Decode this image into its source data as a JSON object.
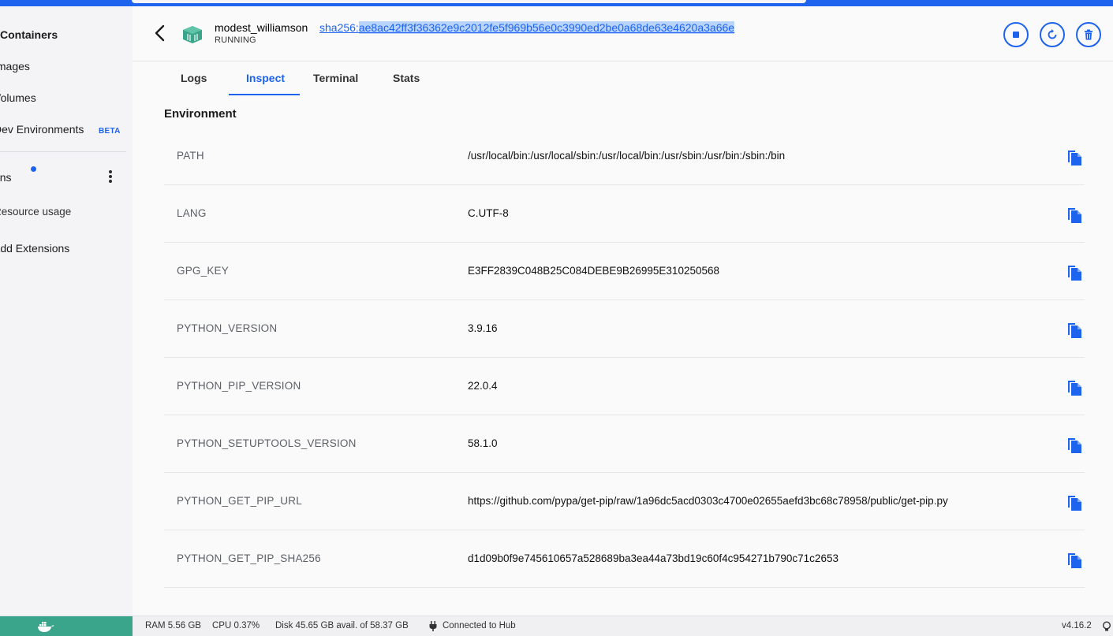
{
  "sidebar": {
    "items": [
      {
        "label": "Containers"
      },
      {
        "label": "Images"
      },
      {
        "label": "Volumes"
      },
      {
        "label": "Dev Environments",
        "badge": "BETA"
      },
      {
        "label": "Extensions"
      },
      {
        "label": "Resource usage"
      },
      {
        "label": "Add Extensions"
      }
    ]
  },
  "header": {
    "container_name": "modest_williamson",
    "status": "RUNNING",
    "hash_prefix": "sha256:",
    "hash_value": "ae8ac42ff3f36362e9c2012fe5f969b56e0c3990ed2be0a68de63e4620a3a66e",
    "container_icon": "container-icon",
    "actions": [
      "stop-icon",
      "restart-icon",
      "delete-icon"
    ]
  },
  "tabs": [
    {
      "label": "Logs"
    },
    {
      "label": "Inspect",
      "active": true
    },
    {
      "label": "Terminal"
    },
    {
      "label": "Stats"
    }
  ],
  "section_title": "Environment",
  "environment": [
    {
      "key": "PATH",
      "value": "/usr/local/bin:/usr/local/sbin:/usr/local/bin:/usr/sbin:/usr/bin:/sbin:/bin"
    },
    {
      "key": "LANG",
      "value": "C.UTF-8"
    },
    {
      "key": "GPG_KEY",
      "value": "E3FF2839C048B25C084DEBE9B26995E310250568"
    },
    {
      "key": "PYTHON_VERSION",
      "value": "3.9.16"
    },
    {
      "key": "PYTHON_PIP_VERSION",
      "value": "22.0.4"
    },
    {
      "key": "PYTHON_SETUPTOOLS_VERSION",
      "value": "58.1.0"
    },
    {
      "key": "PYTHON_GET_PIP_URL",
      "value": "https://github.com/pypa/get-pip/raw/1a96dc5acd0303c4700e02655aefd3bc68c78958/public/get-pip.py"
    },
    {
      "key": "PYTHON_GET_PIP_SHA256",
      "value": "d1d09b0f9e745610657a528689ba3ea44a73bd19c60f4c954271b790c71c2653"
    }
  ],
  "statusbar": {
    "ram": "RAM 5.56 GB",
    "cpu": "CPU 0.37%",
    "disk": "Disk 45.65 GB avail. of 58.37 GB",
    "hub": "Connected to Hub",
    "version": "v4.16.2"
  },
  "colors": {
    "accent": "#1d63ed",
    "whale_bg": "#3aa58a",
    "container_icon": "#3aa58a"
  }
}
